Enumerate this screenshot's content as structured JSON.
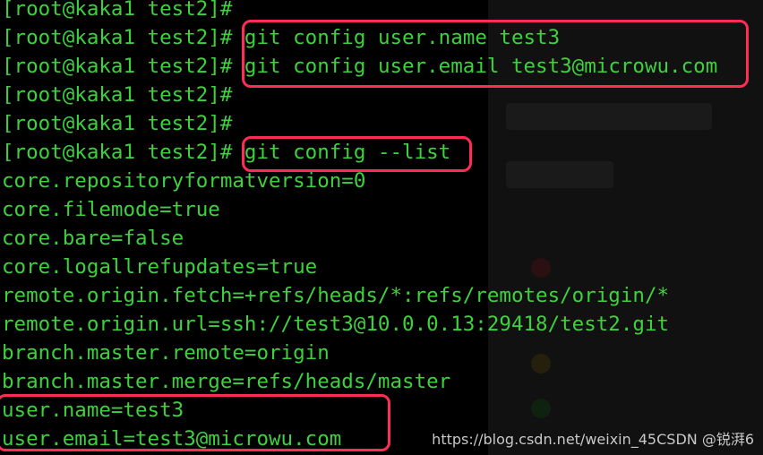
{
  "terminal": {
    "prompt": "[root@kaka1 test2]#",
    "lines": [
      {
        "kind": "prompt",
        "prompt": "[root@kaka1 test2]#",
        "command": ""
      },
      {
        "kind": "prompt",
        "prompt": "[root@kaka1 test2]#",
        "command": " git config user.name test3"
      },
      {
        "kind": "prompt",
        "prompt": "[root@kaka1 test2]#",
        "command": " git config user.email test3@microwu.com"
      },
      {
        "kind": "prompt",
        "prompt": "[root@kaka1 test2]#",
        "command": ""
      },
      {
        "kind": "prompt",
        "prompt": "[root@kaka1 test2]#",
        "command": ""
      },
      {
        "kind": "prompt",
        "prompt": "[root@kaka1 test2]#",
        "command": " git config --list"
      },
      {
        "kind": "output",
        "text": "core.repositoryformatversion=0"
      },
      {
        "kind": "output",
        "text": "core.filemode=true"
      },
      {
        "kind": "output",
        "text": "core.bare=false"
      },
      {
        "kind": "output",
        "text": "core.logallrefupdates=true"
      },
      {
        "kind": "output",
        "text": "remote.origin.fetch=+refs/heads/*:refs/remotes/origin/*"
      },
      {
        "kind": "output",
        "text": "remote.origin.url=ssh://test3@10.0.0.13:29418/test2.git"
      },
      {
        "kind": "output",
        "text": "branch.master.remote=origin"
      },
      {
        "kind": "output",
        "text": "branch.master.merge=refs/heads/master"
      },
      {
        "kind": "output",
        "text": "user.name=test3"
      },
      {
        "kind": "output",
        "text": "user.email=test3@microwu.com"
      }
    ],
    "text_color": "#3ed13e",
    "background": "#000000"
  },
  "annotations": {
    "highlight_color": "#ff2d55"
  },
  "watermark": {
    "text": "https://blog.csdn.net/weixin_45⁠CSDN @锐湃6"
  }
}
